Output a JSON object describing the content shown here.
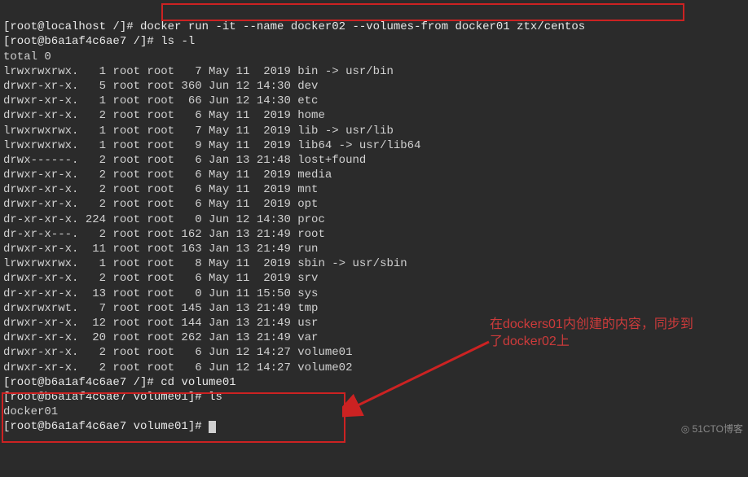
{
  "line1_prompt": "[root@localhost /]# ",
  "line1_cmd": "docker run -it --name docker02 --volumes-from docker01 ztx/centos",
  "line2_prompt": "[root@b6a1af4c6ae7 /]# ",
  "line2_cmd": "ls -l",
  "line3": "total 0",
  "ls_rows": [
    "lrwxrwxrwx.   1 root root   7 May 11  2019 bin -> usr/bin",
    "drwxr-xr-x.   5 root root 360 Jun 12 14:30 dev",
    "drwxr-xr-x.   1 root root  66 Jun 12 14:30 etc",
    "drwxr-xr-x.   2 root root   6 May 11  2019 home",
    "lrwxrwxrwx.   1 root root   7 May 11  2019 lib -> usr/lib",
    "lrwxrwxrwx.   1 root root   9 May 11  2019 lib64 -> usr/lib64",
    "drwx------.   2 root root   6 Jan 13 21:48 lost+found",
    "drwxr-xr-x.   2 root root   6 May 11  2019 media",
    "drwxr-xr-x.   2 root root   6 May 11  2019 mnt",
    "drwxr-xr-x.   2 root root   6 May 11  2019 opt",
    "dr-xr-xr-x. 224 root root   0 Jun 12 14:30 proc",
    "dr-xr-x---.   2 root root 162 Jan 13 21:49 root",
    "drwxr-xr-x.  11 root root 163 Jan 13 21:49 run",
    "lrwxrwxrwx.   1 root root   8 May 11  2019 sbin -> usr/sbin",
    "drwxr-xr-x.   2 root root   6 May 11  2019 srv",
    "dr-xr-xr-x.  13 root root   0 Jun 11 15:50 sys",
    "drwxrwxrwt.   7 root root 145 Jan 13 21:49 tmp",
    "drwxr-xr-x.  12 root root 144 Jan 13 21:49 usr",
    "drwxr-xr-x.  20 root root 262 Jan 13 21:49 var",
    "drwxr-xr-x.   2 root root   6 Jun 12 14:27 volume01",
    "drwxr-xr-x.   2 root root   6 Jun 12 14:27 volume02"
  ],
  "line_cd_prompt": "[root@b6a1af4c6ae7 /]# ",
  "line_cd_cmd": "cd volume01",
  "line_ls2_prompt": "[root@b6a1af4c6ae7 volume01]# ",
  "line_ls2_cmd": "ls",
  "line_ls2_out": "docker01",
  "line_final_prompt": "[root@b6a1af4c6ae7 volume01]# ",
  "annotation_text": "在dockers01内创建的内容，同步到了docker02上",
  "watermark": "◎ 51CTO博客"
}
